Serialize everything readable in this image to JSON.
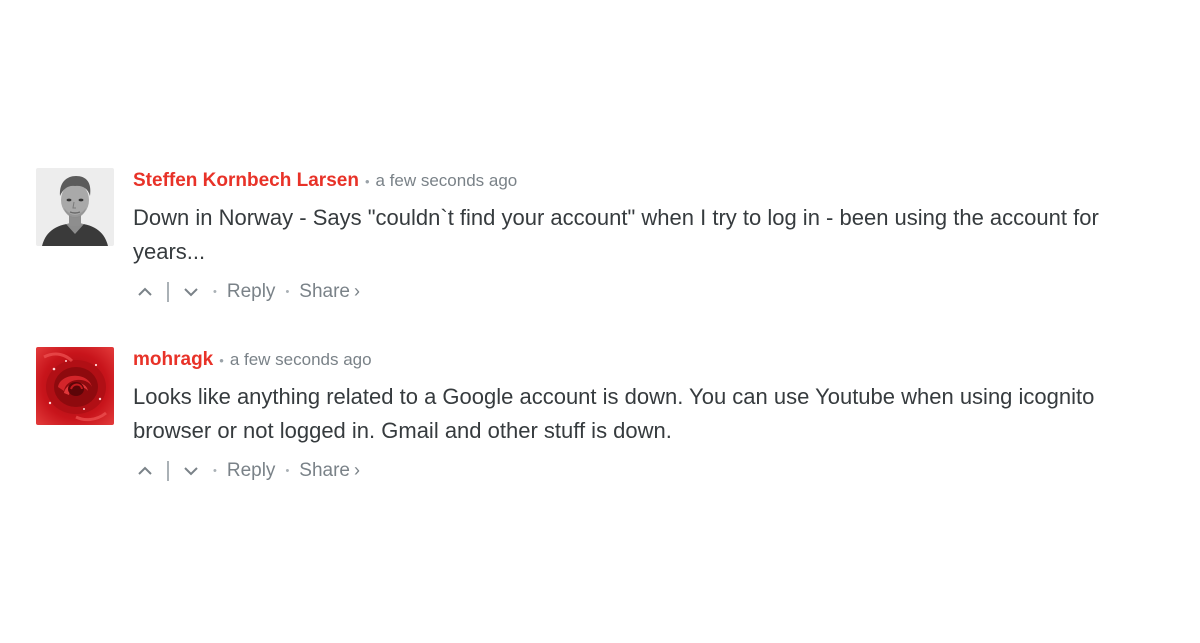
{
  "comments": [
    {
      "author": "Steffen Kornbech Larsen",
      "time": "a few seconds ago",
      "text": "Down in Norway - Says \"couldn`t find your account\" when I try to log in - been using the account for years...",
      "reply_label": "Reply",
      "share_label": "Share",
      "share_glyph": "›",
      "avatar_icon": "person-photo-avatar"
    },
    {
      "author": "mohragk",
      "time": "a few seconds ago",
      "text": "Looks like anything related to a Google account is down. You can use Youtube when using icognito browser or not logged in. Gmail and other stuff is down.",
      "reply_label": "Reply",
      "share_label": "Share",
      "share_glyph": "›",
      "avatar_icon": "red-rose-avatar"
    }
  ],
  "separator": "•",
  "colors": {
    "author": "#e83228",
    "meta": "#7a8288",
    "text": "#363b3e"
  }
}
